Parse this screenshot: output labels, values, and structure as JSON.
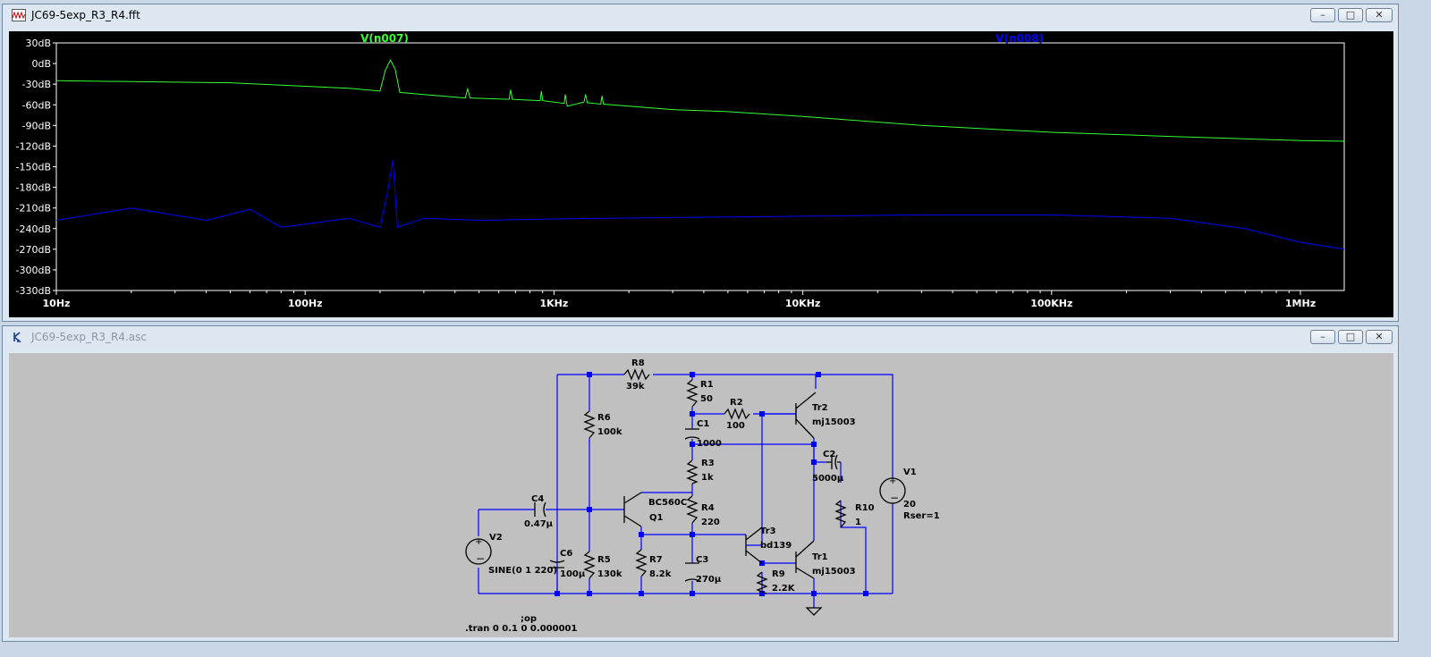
{
  "fft_window": {
    "title": "JC69-5exp_R3_R4.fft",
    "icon": "waveform-icon",
    "buttons": [
      "minimize",
      "maximize",
      "close"
    ]
  },
  "chart_data": {
    "type": "line",
    "x_scale": "log",
    "xlim": [
      10,
      1500000
    ],
    "ylim": [
      -330,
      30
    ],
    "x_ticks": [
      "10Hz",
      "100Hz",
      "1KHz",
      "10KHz",
      "100KHz",
      "1MHz"
    ],
    "y_ticks": [
      "30dB",
      "0dB",
      "-30dB",
      "-60dB",
      "-90dB",
      "-120dB",
      "-150dB",
      "-180dB",
      "-210dB",
      "-240dB",
      "-270dB",
      "-300dB",
      "-330dB"
    ],
    "grid": false,
    "background": "#000000",
    "series": [
      {
        "name": "V(n007)",
        "color": "#33ff33",
        "points": [
          [
            10,
            -25
          ],
          [
            50,
            -28
          ],
          [
            150,
            -36
          ],
          [
            200,
            -40
          ],
          [
            210,
            -10
          ],
          [
            220,
            5
          ],
          [
            230,
            -8
          ],
          [
            240,
            -42
          ],
          [
            300,
            -45
          ],
          [
            440,
            -50
          ],
          [
            450,
            -37
          ],
          [
            460,
            -50
          ],
          [
            660,
            -52
          ],
          [
            670,
            -38
          ],
          [
            680,
            -52
          ],
          [
            880,
            -54
          ],
          [
            890,
            -40
          ],
          [
            900,
            -54
          ],
          [
            1100,
            -58
          ],
          [
            1110,
            -45
          ],
          [
            1130,
            -62
          ],
          [
            1320,
            -56
          ],
          [
            1340,
            -45
          ],
          [
            1360,
            -57
          ],
          [
            1540,
            -59
          ],
          [
            1560,
            -47
          ],
          [
            1580,
            -59
          ],
          [
            2000,
            -62
          ],
          [
            3000,
            -67
          ],
          [
            5000,
            -70
          ],
          [
            10000,
            -77
          ],
          [
            30000,
            -90
          ],
          [
            100000,
            -100
          ],
          [
            300000,
            -106
          ],
          [
            1000000,
            -112
          ],
          [
            1500000,
            -113
          ]
        ]
      },
      {
        "name": "V(n008)",
        "color": "#0000ff",
        "points": [
          [
            10,
            -228
          ],
          [
            20,
            -210
          ],
          [
            40,
            -228
          ],
          [
            60,
            -212
          ],
          [
            80,
            -238
          ],
          [
            150,
            -225
          ],
          [
            200,
            -238
          ],
          [
            215,
            -185
          ],
          [
            225,
            -140
          ],
          [
            235,
            -238
          ],
          [
            300,
            -225
          ],
          [
            500,
            -228
          ],
          [
            1000,
            -226
          ],
          [
            3000,
            -224
          ],
          [
            10000,
            -222
          ],
          [
            30000,
            -220
          ],
          [
            100000,
            -220
          ],
          [
            300000,
            -225
          ],
          [
            600000,
            -240
          ],
          [
            1000000,
            -260
          ],
          [
            1500000,
            -270
          ]
        ]
      }
    ]
  },
  "schematic_window": {
    "title": "JC69-5exp_R3_R4.asc",
    "icon": "schematic-icon",
    "buttons": [
      "minimize",
      "maximize",
      "close"
    ]
  },
  "schematic": {
    "wire_color": "#0000ff",
    "components": {
      "R8": {
        "ref": "R8",
        "value": "39k"
      },
      "R1": {
        "ref": "R1",
        "value": "50"
      },
      "R2": {
        "ref": "R2",
        "value": "100"
      },
      "C1": {
        "ref": "C1",
        "value": "1000"
      },
      "R3": {
        "ref": "R3",
        "value": "1k"
      },
      "R4": {
        "ref": "R4",
        "value": "220"
      },
      "C3": {
        "ref": "C3",
        "value": "270µ"
      },
      "R6": {
        "ref": "R6",
        "value": "100k"
      },
      "R5": {
        "ref": "R5",
        "value": "130k"
      },
      "R7": {
        "ref": "R7",
        "value": "8.2k"
      },
      "C4": {
        "ref": "C4",
        "value": "0.47µ"
      },
      "C6": {
        "ref": "C6",
        "value": "100µ"
      },
      "V2": {
        "ref": "V2",
        "value": "SINE(0 1 220)"
      },
      "Q1": {
        "ref": "Q1",
        "value": "BC560C"
      },
      "Tr2": {
        "ref": "Tr2",
        "value": "mj15003"
      },
      "Tr3": {
        "ref": "Tr3",
        "value": "bd139"
      },
      "Tr1": {
        "ref": "Tr1",
        "value": "mj15003"
      },
      "R9": {
        "ref": "R9",
        "value": "2.2K"
      },
      "C2": {
        "ref": "C2",
        "value": "5000µ"
      },
      "R10": {
        "ref": "R10",
        "value": "1"
      },
      "V1": {
        "ref": "V1",
        "value": "20",
        "extra": "Rser=1"
      }
    },
    "directives": [
      ";op",
      ".tran 0 0.1 0 0.000001"
    ]
  }
}
